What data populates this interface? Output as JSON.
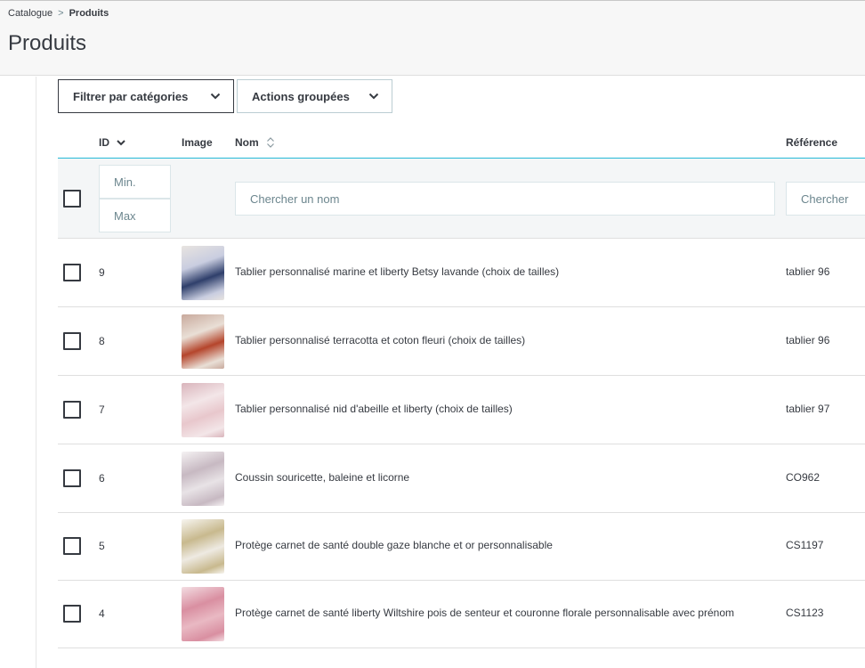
{
  "breadcrumb": {
    "parent": "Catalogue",
    "separator": ">",
    "current": "Produits"
  },
  "page_title": "Produits",
  "toolbar": {
    "filter_label": "Filtrer par catégories",
    "actions_label": "Actions groupées"
  },
  "columns": {
    "id": "ID",
    "image": "Image",
    "name": "Nom",
    "reference": "Référence"
  },
  "filters": {
    "id_min_placeholder": "Min.",
    "id_max_placeholder": "Max",
    "name_placeholder": "Chercher un nom",
    "reference_placeholder": "Chercher"
  },
  "products": [
    {
      "id": "9",
      "name": "Tablier personnalisé marine et liberty Betsy lavande (choix de tailles)",
      "reference": "tablier 96",
      "thumb_colors": [
        "#2f3f6b",
        "#c9cde0",
        "#e8e4e0"
      ]
    },
    {
      "id": "8",
      "name": "Tablier personnalisé terracotta et coton fleuri (choix de tailles)",
      "reference": "tablier 96",
      "thumb_colors": [
        "#b5452c",
        "#e9dfd6",
        "#c8a99c"
      ]
    },
    {
      "id": "7",
      "name": "Tablier personnalisé nid d'abeille et liberty (choix de tailles)",
      "reference": "tablier 97",
      "thumb_colors": [
        "#e8c7cc",
        "#f3e6e8",
        "#d9b4bb"
      ]
    },
    {
      "id": "6",
      "name": "Coussin souricette, baleine et licorne",
      "reference": "CO962",
      "thumb_colors": [
        "#e8e3e6",
        "#c7b9c2",
        "#f5f2f3"
      ]
    },
    {
      "id": "5",
      "name": "Protège carnet de santé double gaze blanche et or personnalisable",
      "reference": "CS1197",
      "thumb_colors": [
        "#eeeae2",
        "#c8b98e",
        "#f7f5f0"
      ]
    },
    {
      "id": "4",
      "name": "Protège carnet de santé liberty Wiltshire pois de senteur et couronne florale personnalisable avec prénom",
      "reference": "CS1123",
      "thumb_colors": [
        "#e9b9c3",
        "#d98fa1",
        "#f3dde2"
      ]
    }
  ]
}
